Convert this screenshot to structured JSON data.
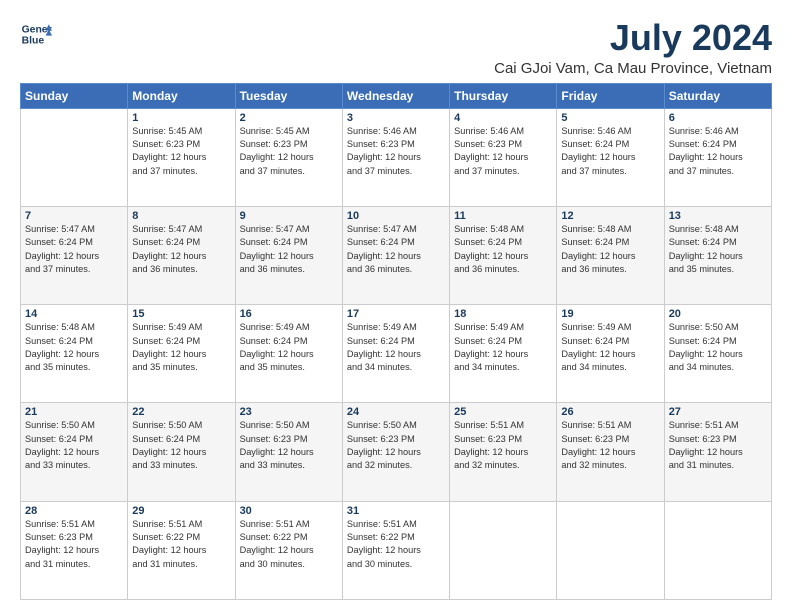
{
  "logo": {
    "line1": "General",
    "line2": "Blue"
  },
  "title": "July 2024",
  "subtitle": "Cai GJoi Vam, Ca Mau Province, Vietnam",
  "header": {
    "days": [
      "Sunday",
      "Monday",
      "Tuesday",
      "Wednesday",
      "Thursday",
      "Friday",
      "Saturday"
    ]
  },
  "weeks": [
    [
      {
        "day": "",
        "info": ""
      },
      {
        "day": "1",
        "info": "Sunrise: 5:45 AM\nSunset: 6:23 PM\nDaylight: 12 hours\nand 37 minutes."
      },
      {
        "day": "2",
        "info": "Sunrise: 5:45 AM\nSunset: 6:23 PM\nDaylight: 12 hours\nand 37 minutes."
      },
      {
        "day": "3",
        "info": "Sunrise: 5:46 AM\nSunset: 6:23 PM\nDaylight: 12 hours\nand 37 minutes."
      },
      {
        "day": "4",
        "info": "Sunrise: 5:46 AM\nSunset: 6:23 PM\nDaylight: 12 hours\nand 37 minutes."
      },
      {
        "day": "5",
        "info": "Sunrise: 5:46 AM\nSunset: 6:24 PM\nDaylight: 12 hours\nand 37 minutes."
      },
      {
        "day": "6",
        "info": "Sunrise: 5:46 AM\nSunset: 6:24 PM\nDaylight: 12 hours\nand 37 minutes."
      }
    ],
    [
      {
        "day": "7",
        "info": "Sunrise: 5:47 AM\nSunset: 6:24 PM\nDaylight: 12 hours\nand 37 minutes."
      },
      {
        "day": "8",
        "info": "Sunrise: 5:47 AM\nSunset: 6:24 PM\nDaylight: 12 hours\nand 36 minutes."
      },
      {
        "day": "9",
        "info": "Sunrise: 5:47 AM\nSunset: 6:24 PM\nDaylight: 12 hours\nand 36 minutes."
      },
      {
        "day": "10",
        "info": "Sunrise: 5:47 AM\nSunset: 6:24 PM\nDaylight: 12 hours\nand 36 minutes."
      },
      {
        "day": "11",
        "info": "Sunrise: 5:48 AM\nSunset: 6:24 PM\nDaylight: 12 hours\nand 36 minutes."
      },
      {
        "day": "12",
        "info": "Sunrise: 5:48 AM\nSunset: 6:24 PM\nDaylight: 12 hours\nand 36 minutes."
      },
      {
        "day": "13",
        "info": "Sunrise: 5:48 AM\nSunset: 6:24 PM\nDaylight: 12 hours\nand 35 minutes."
      }
    ],
    [
      {
        "day": "14",
        "info": "Sunrise: 5:48 AM\nSunset: 6:24 PM\nDaylight: 12 hours\nand 35 minutes."
      },
      {
        "day": "15",
        "info": "Sunrise: 5:49 AM\nSunset: 6:24 PM\nDaylight: 12 hours\nand 35 minutes."
      },
      {
        "day": "16",
        "info": "Sunrise: 5:49 AM\nSunset: 6:24 PM\nDaylight: 12 hours\nand 35 minutes."
      },
      {
        "day": "17",
        "info": "Sunrise: 5:49 AM\nSunset: 6:24 PM\nDaylight: 12 hours\nand 34 minutes."
      },
      {
        "day": "18",
        "info": "Sunrise: 5:49 AM\nSunset: 6:24 PM\nDaylight: 12 hours\nand 34 minutes."
      },
      {
        "day": "19",
        "info": "Sunrise: 5:49 AM\nSunset: 6:24 PM\nDaylight: 12 hours\nand 34 minutes."
      },
      {
        "day": "20",
        "info": "Sunrise: 5:50 AM\nSunset: 6:24 PM\nDaylight: 12 hours\nand 34 minutes."
      }
    ],
    [
      {
        "day": "21",
        "info": "Sunrise: 5:50 AM\nSunset: 6:24 PM\nDaylight: 12 hours\nand 33 minutes."
      },
      {
        "day": "22",
        "info": "Sunrise: 5:50 AM\nSunset: 6:24 PM\nDaylight: 12 hours\nand 33 minutes."
      },
      {
        "day": "23",
        "info": "Sunrise: 5:50 AM\nSunset: 6:23 PM\nDaylight: 12 hours\nand 33 minutes."
      },
      {
        "day": "24",
        "info": "Sunrise: 5:50 AM\nSunset: 6:23 PM\nDaylight: 12 hours\nand 32 minutes."
      },
      {
        "day": "25",
        "info": "Sunrise: 5:51 AM\nSunset: 6:23 PM\nDaylight: 12 hours\nand 32 minutes."
      },
      {
        "day": "26",
        "info": "Sunrise: 5:51 AM\nSunset: 6:23 PM\nDaylight: 12 hours\nand 32 minutes."
      },
      {
        "day": "27",
        "info": "Sunrise: 5:51 AM\nSunset: 6:23 PM\nDaylight: 12 hours\nand 31 minutes."
      }
    ],
    [
      {
        "day": "28",
        "info": "Sunrise: 5:51 AM\nSunset: 6:23 PM\nDaylight: 12 hours\nand 31 minutes."
      },
      {
        "day": "29",
        "info": "Sunrise: 5:51 AM\nSunset: 6:22 PM\nDaylight: 12 hours\nand 31 minutes."
      },
      {
        "day": "30",
        "info": "Sunrise: 5:51 AM\nSunset: 6:22 PM\nDaylight: 12 hours\nand 30 minutes."
      },
      {
        "day": "31",
        "info": "Sunrise: 5:51 AM\nSunset: 6:22 PM\nDaylight: 12 hours\nand 30 minutes."
      },
      {
        "day": "",
        "info": ""
      },
      {
        "day": "",
        "info": ""
      },
      {
        "day": "",
        "info": ""
      }
    ]
  ]
}
